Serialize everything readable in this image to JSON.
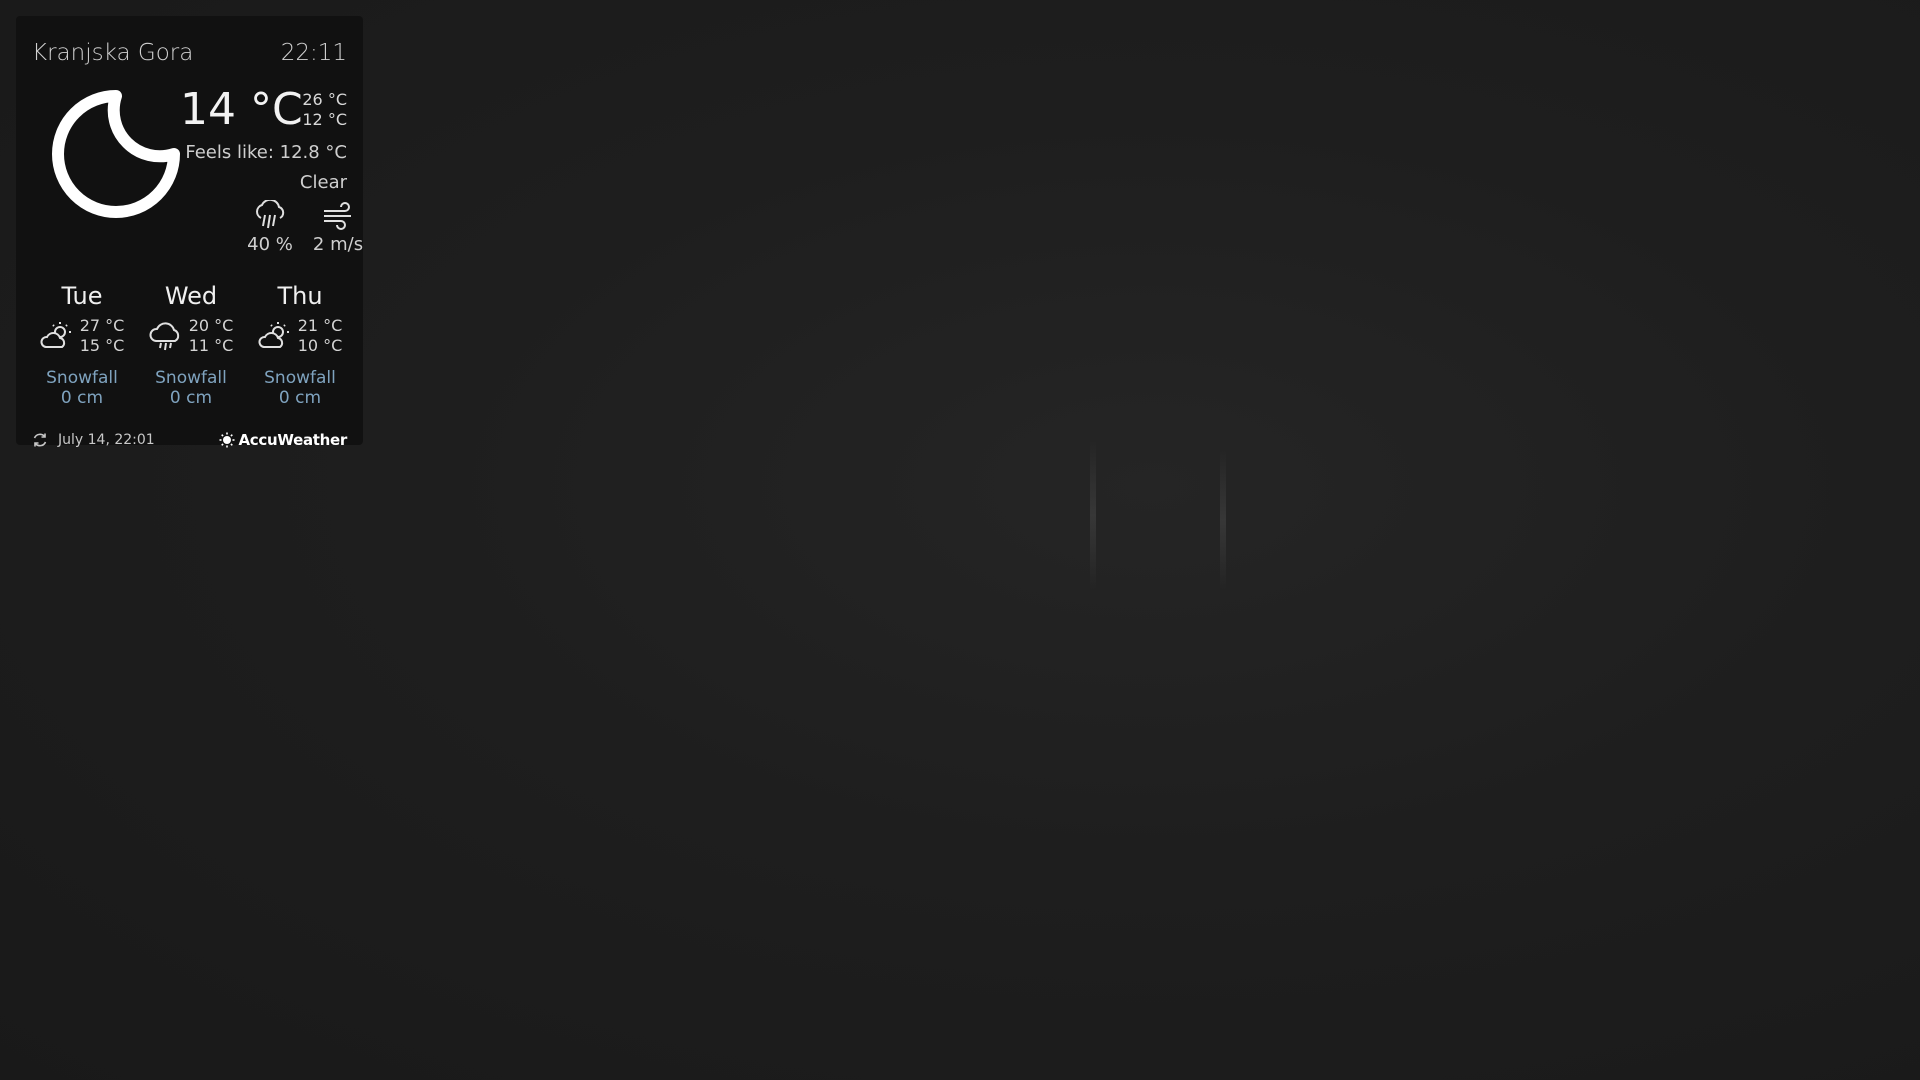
{
  "location": "Kranjska Gora",
  "time": "22:11",
  "current": {
    "temperature": "14 °C",
    "high": "26 °C",
    "low": "12 °C",
    "feels_like": "Feels like: 12.8 °C",
    "condition": "Clear",
    "condition_icon": "moon-icon",
    "precipitation": "40 %",
    "wind": "2 m/s"
  },
  "forecast": [
    {
      "day": "Tue",
      "high": "27 °C",
      "low": "15 °C",
      "icon": "partly-cloudy-icon",
      "snow_label": "Snowfall",
      "snow_value": "0 cm"
    },
    {
      "day": "Wed",
      "high": "20 °C",
      "low": "11 °C",
      "icon": "rain-cloud-icon",
      "snow_label": "Snowfall",
      "snow_value": "0 cm"
    },
    {
      "day": "Thu",
      "high": "21 °C",
      "low": "10 °C",
      "icon": "partly-cloudy-icon",
      "snow_label": "Snowfall",
      "snow_value": "0 cm"
    }
  ],
  "footer": {
    "updated": "July 14, 22:01",
    "provider": "AccuWeather"
  },
  "colors": {
    "snow_text": "#7fa3bf",
    "panel_bg": "#101010"
  }
}
